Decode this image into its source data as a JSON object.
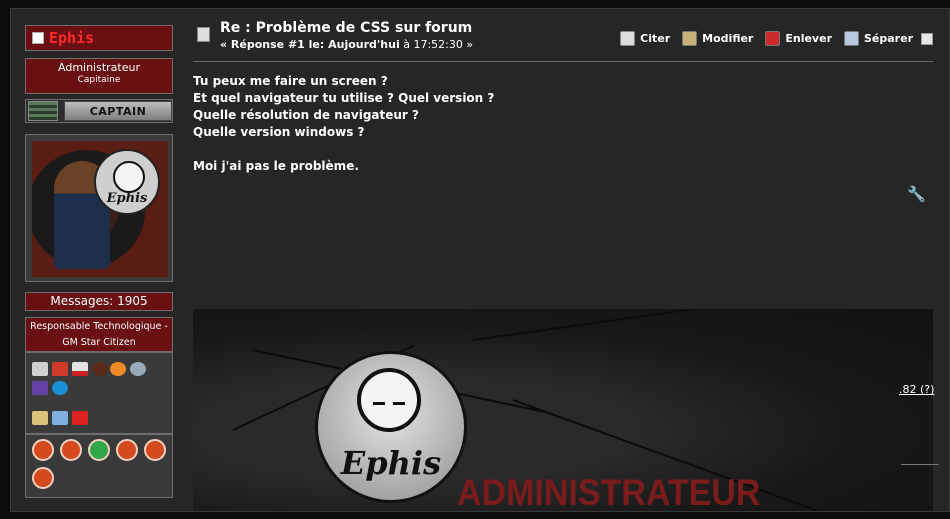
{
  "user": {
    "name": "Ephis",
    "rank_title": "Administrateur",
    "rank_sub": "Capitaine",
    "rank_badge": "CAPTAIN",
    "avatar_text": "Ephis",
    "messages_label": "Messages: 1905",
    "role_line1": "Responsable Technologique -",
    "role_line2": "GM Star Citizen"
  },
  "post": {
    "title": "Re : Problème de CSS sur forum",
    "reply_prefix": "« Réponse #1 le: Aujourd'hui",
    "reply_time": "à 17:52:30 »",
    "body": [
      "Tu peux me faire un screen ?",
      "Et quel navigateur tu utilise ? Quel version ?",
      "Quelle résolution de navigateur ?",
      "Quelle version windows ?",
      "",
      "Moi j'ai pas le problème."
    ]
  },
  "actions": {
    "quote": "Citer",
    "modify": "Modifier",
    "remove": "Enlever",
    "split": "Séparer"
  },
  "signature": {
    "logo_text": "Ephis",
    "banner_text": "ADMINISTRATEUR",
    "side_link": ".82 (?)"
  },
  "social_icons": [
    "steam-icon",
    "google-plus-icon",
    "youtube-icon",
    "dota-icon",
    "overwatch-icon",
    "globe-icon",
    "twitch-icon",
    "uplay-icon",
    "contact-icon",
    "email-icon",
    "pm-icon"
  ],
  "colors": {
    "accent_red": "#6a0f12",
    "name_red": "#ff2a2a"
  }
}
